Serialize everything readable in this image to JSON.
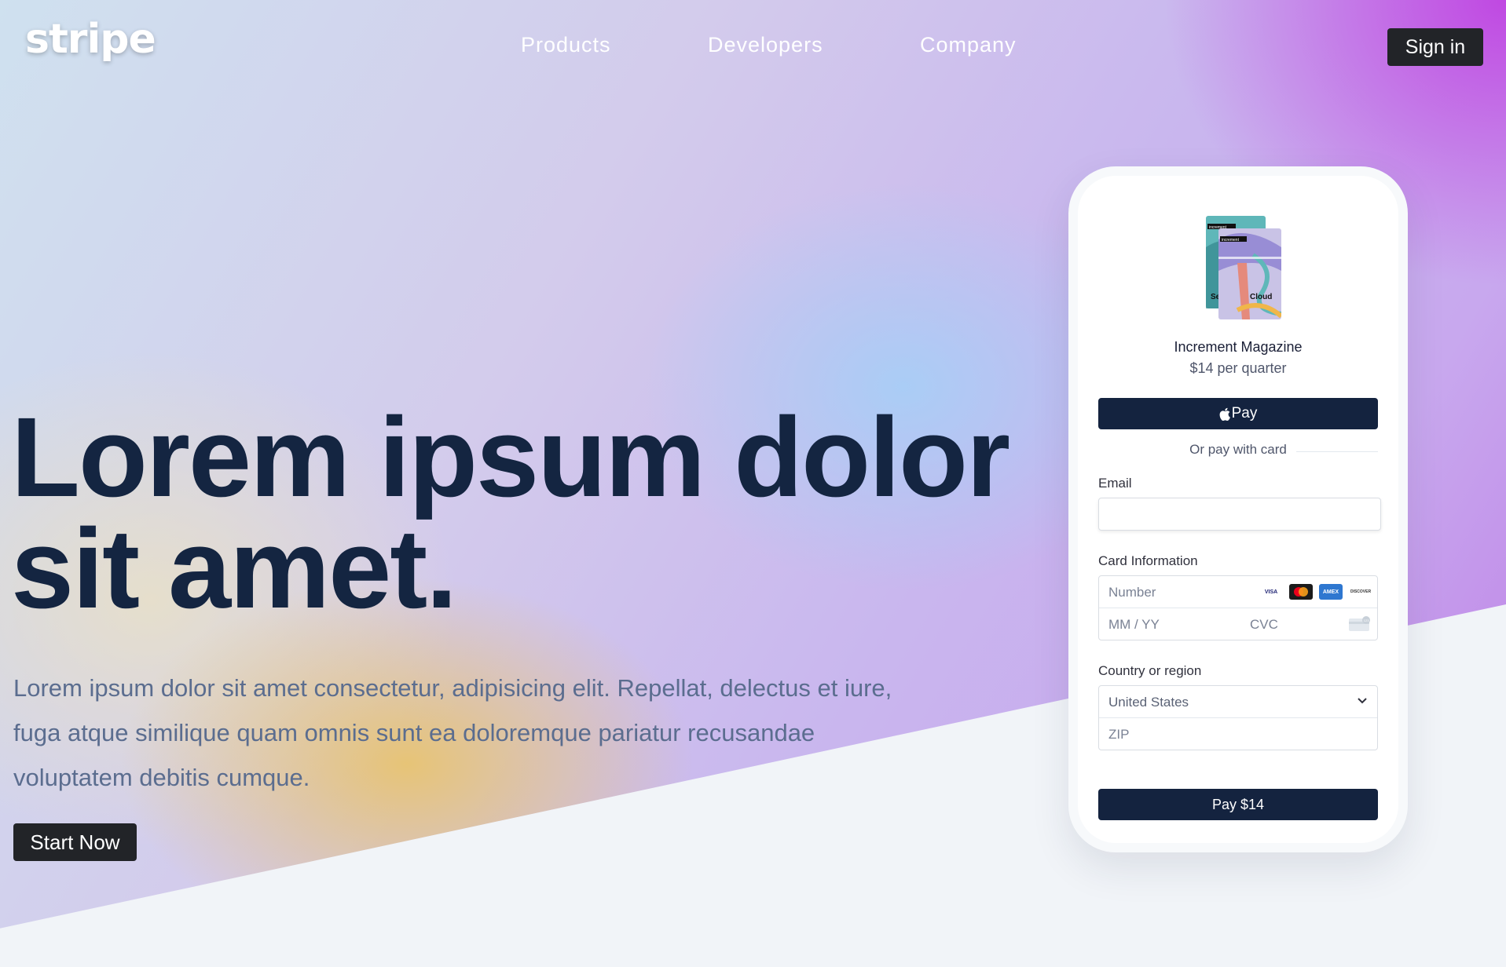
{
  "brand": {
    "logo_text": "stripe"
  },
  "nav": {
    "links": [
      "Products",
      "Developers",
      "Company"
    ],
    "signin_label": "Sign in"
  },
  "hero": {
    "headline": "Lorem ipsum dolor sit amet.",
    "subtext": "Lorem ipsum dolor sit amet consectetur, adipisicing elit. Repellat, delectus et iure, fuga atque similique quam omnis sunt ea doloremque pariatur recusandae voluptatem debitis cumque.",
    "cta_label": "Start Now"
  },
  "checkout": {
    "product_art_labels": [
      "increment",
      "increment",
      "Se",
      "Cloud"
    ],
    "product_name": "Increment Magazine",
    "product_price": "$14 per quarter",
    "applepay_label": "Pay",
    "divider_text": "Or pay with card",
    "email_label": "Email",
    "email_value": "",
    "card_label": "Card Information",
    "card_number_placeholder": "Number",
    "card_brands": [
      "VISA",
      "mastercard",
      "AMEX",
      "DISCOVER"
    ],
    "expiry_placeholder": "MM / YY",
    "cvc_placeholder": "CVC",
    "cvc_icon_text": "123",
    "country_label": "Country or region",
    "country_value": "United States",
    "zip_placeholder": "ZIP",
    "pay_button_label": "Pay $14"
  },
  "colors": {
    "navy": "#14233f",
    "headline": "#142541",
    "subtext": "#5b6d8f",
    "button_dark": "#222428",
    "page_bg": "#f1f4f8"
  }
}
